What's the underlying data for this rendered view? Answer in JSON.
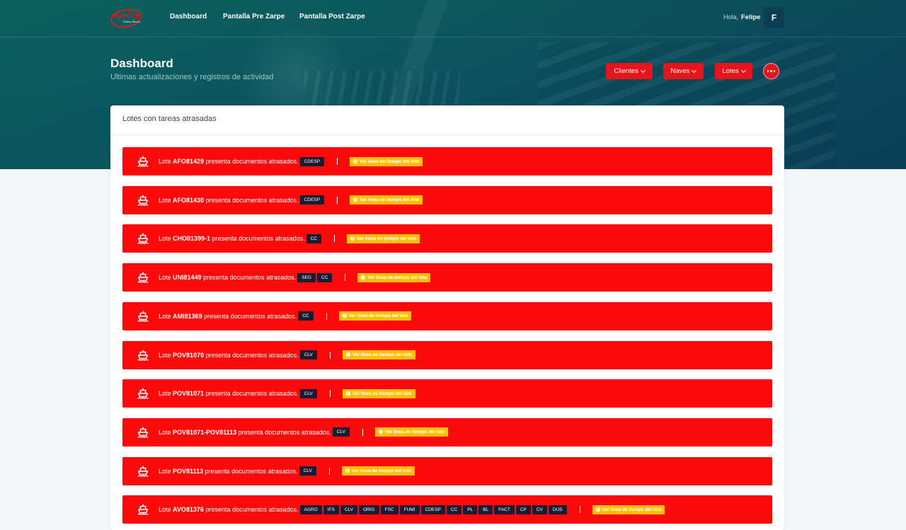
{
  "brand": {
    "logo_main": "AgroTop",
    "logo_sub": "Frutos Secos",
    "color_primary": "#e8141b"
  },
  "nav": [
    {
      "label": "Dashboard"
    },
    {
      "label": "Pantalla Pre Zarpe"
    },
    {
      "label": "Pantalla Post Zarpe"
    }
  ],
  "user": {
    "greeting": "Hola,",
    "name": "Felipe",
    "initial": "F"
  },
  "page": {
    "title": "Dashboard",
    "subtitle": "Ultimas actualizaciones y registros de actividad"
  },
  "toolbar": [
    {
      "label": "Clientes"
    },
    {
      "label": "Naves"
    },
    {
      "label": "Lotes"
    }
  ],
  "card": {
    "title": "Lotes con tareas atrasadas"
  },
  "alert_text": {
    "prefix": "Lote",
    "suffix": "presenta documentos atrasados.",
    "timeline_label": "Ver línea de tiempo del lote"
  },
  "alerts": [
    {
      "lot": "AFO81429",
      "tags": [
        "CDESP"
      ]
    },
    {
      "lot": "AFO81430",
      "tags": [
        "CDESP"
      ]
    },
    {
      "lot": "CHO81399-1",
      "tags": [
        "CC"
      ]
    },
    {
      "lot": "UNI81449",
      "tags": [
        "SEG",
        "CC"
      ]
    },
    {
      "lot": "AMI81369",
      "tags": [
        "CC"
      ]
    },
    {
      "lot": "POV81070",
      "tags": [
        "CLV"
      ]
    },
    {
      "lot": "POV81071",
      "tags": [
        "CLV"
      ]
    },
    {
      "lot": "POV81071-POV81113",
      "tags": [
        "CLV"
      ]
    },
    {
      "lot": "POV81113",
      "tags": [
        "CLV"
      ]
    },
    {
      "lot": "AVO81376",
      "tags": [
        "AGRO",
        "IFS",
        "CLV",
        "ORIG",
        "FSC",
        "FUMI",
        "CDESP",
        "CC",
        "PL",
        "BL",
        "FACT",
        "CP",
        "CV",
        "DUS"
      ]
    }
  ]
}
